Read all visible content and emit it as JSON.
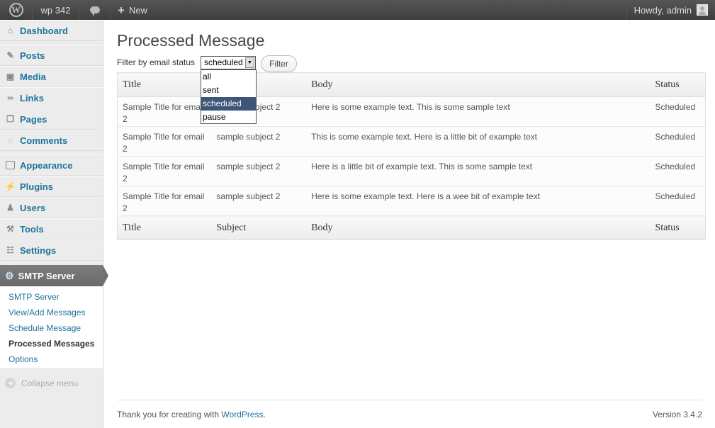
{
  "adminbar": {
    "site_name": "wp 342",
    "new_label": "New",
    "howdy": "Howdy, admin"
  },
  "sidebar": {
    "items": [
      {
        "label": "Dashboard",
        "icon": "dashboard-icon"
      },
      {
        "label": "Posts",
        "icon": "pushpin-icon"
      },
      {
        "label": "Media",
        "icon": "media-icon"
      },
      {
        "label": "Links",
        "icon": "link-icon"
      },
      {
        "label": "Pages",
        "icon": "pages-icon"
      },
      {
        "label": "Comments",
        "icon": "comments-icon"
      },
      {
        "label": "Appearance",
        "icon": "appearance-icon"
      },
      {
        "label": "Plugins",
        "icon": "plug-icon"
      },
      {
        "label": "Users",
        "icon": "users-icon"
      },
      {
        "label": "Tools",
        "icon": "tools-icon"
      },
      {
        "label": "Settings",
        "icon": "settings-icon"
      }
    ],
    "active_menu": "SMTP Server",
    "submenu": [
      "SMTP Server",
      "View/Add Messages",
      "Schedule Message",
      "Processed Messages",
      "Options"
    ],
    "collapse_label": "Collapse menu"
  },
  "page": {
    "title": "Processed Message",
    "filter_label": "Filter by email status",
    "filter_value": "scheduled",
    "filter_options": [
      "all",
      "sent",
      "scheduled",
      "pause"
    ],
    "filter_button": "Filter"
  },
  "table": {
    "columns": [
      "Title",
      "Subject",
      "Body",
      "Status"
    ],
    "rows": [
      {
        "title": "Sample Title for email 2",
        "subject": "sample subject 2",
        "body": "Here is some example text. This is some sample text",
        "status": "Scheduled"
      },
      {
        "title": "Sample Title for email 2",
        "subject": "sample subject 2",
        "body": "This is some example text. Here is a little bit of example text",
        "status": "Scheduled"
      },
      {
        "title": "Sample Title for email 2",
        "subject": "sample subject 2",
        "body": "Here is a little bit of example text. This is some sample text",
        "status": "Scheduled"
      },
      {
        "title": "Sample Title for email 2",
        "subject": "sample subject 2",
        "body": "Here is some example text. Here is a wee bit of example text",
        "status": "Scheduled"
      }
    ]
  },
  "footer": {
    "thanks_prefix": "Thank you for creating with ",
    "thanks_link": "WordPress",
    "thanks_suffix": ".",
    "version": "Version 3.4.2"
  }
}
